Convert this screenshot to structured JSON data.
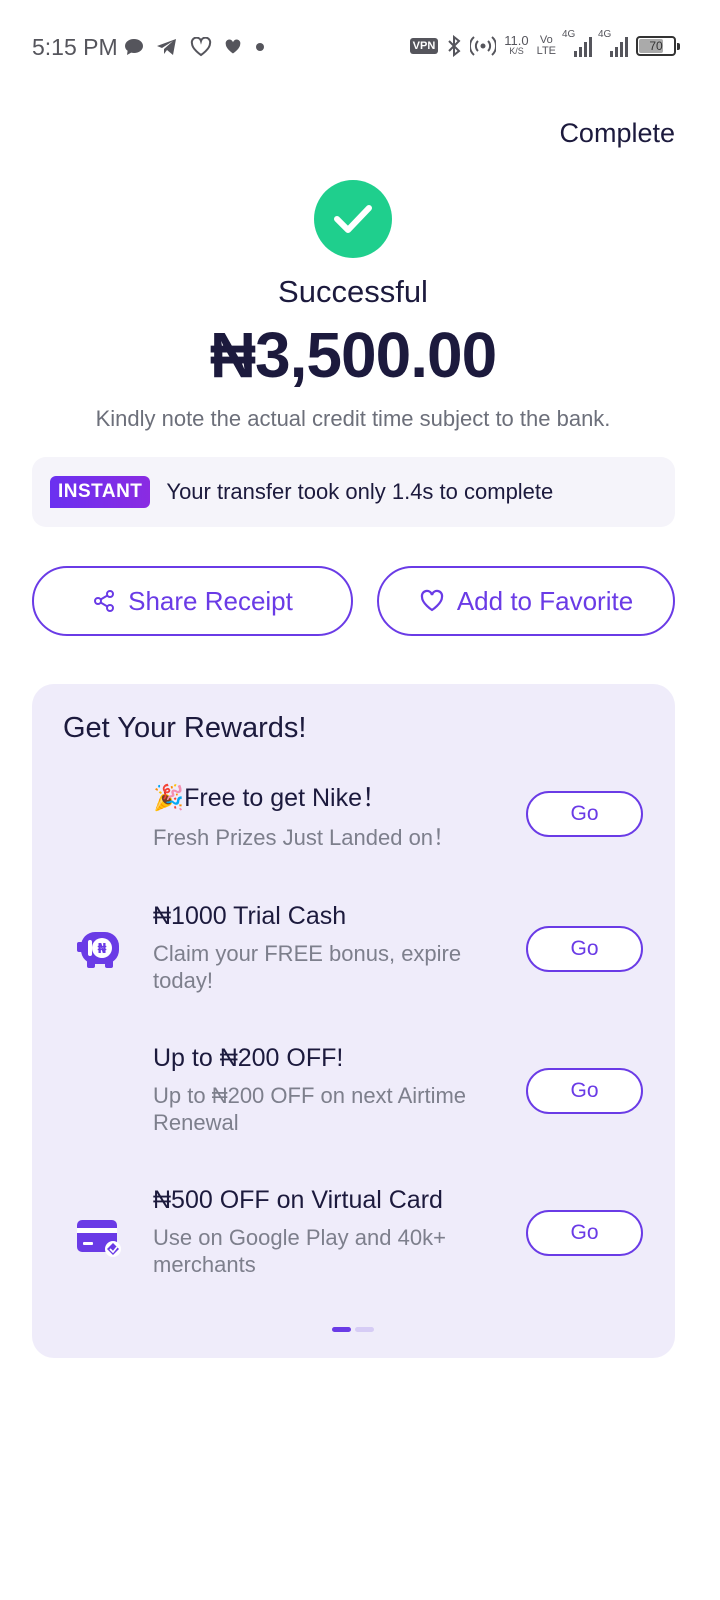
{
  "status_bar": {
    "time": "5:15 PM",
    "vpn": "VPN",
    "net_speed_value": "11.0",
    "net_speed_unit": "K/S",
    "volte_top": "Vo",
    "volte_bottom": "LTE",
    "sig1_label": "4G",
    "sig2_label": "4G",
    "battery": "70"
  },
  "header": {
    "complete_label": "Complete"
  },
  "result": {
    "status": "Successful",
    "amount": "₦3,500.00",
    "note": "Kindly note the actual credit time subject to the bank."
  },
  "instant": {
    "badge": "INSTANT",
    "text": "Your transfer took only 1.4s to complete"
  },
  "actions": {
    "share_label": "Share Receipt",
    "favorite_label": "Add to Favorite"
  },
  "rewards": {
    "title": "Get Your Rewards!",
    "items": [
      {
        "title": "🎉Free to get Nike！",
        "desc": "Fresh Prizes Just Landed on！",
        "go": "Go",
        "icon": "none"
      },
      {
        "title": "₦1000 Trial Cash",
        "desc": "Claim your FREE bonus, expire today!",
        "go": "Go",
        "icon": "piggy-bank-icon"
      },
      {
        "title": "Up to ₦200 OFF!",
        "desc": "Up to ₦200 OFF on next Airtime Renewal",
        "go": "Go",
        "icon": "none"
      },
      {
        "title": "₦500 OFF on Virtual Card",
        "desc": "Use on Google Play and 40k+ merchants",
        "go": "Go",
        "icon": "virtual-card-icon"
      }
    ]
  },
  "colors": {
    "accent": "#6a3be6",
    "success": "#1fcf8d",
    "card_bg": "#efecfa"
  }
}
